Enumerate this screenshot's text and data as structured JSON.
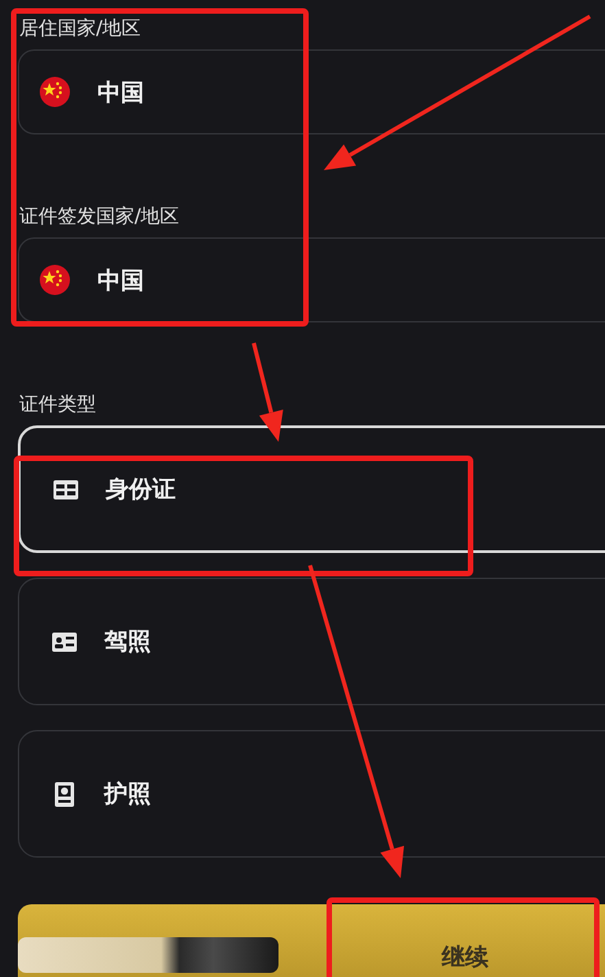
{
  "residence": {
    "label": "居住国家/地区",
    "value": "中国"
  },
  "issuing_country": {
    "label": "证件签发国家/地区",
    "value": "中国"
  },
  "id_type": {
    "label": "证件类型",
    "options": [
      {
        "label": "身份证",
        "kind": "id-card",
        "selected": true
      },
      {
        "label": "驾照",
        "kind": "license",
        "selected": false
      },
      {
        "label": "护照",
        "kind": "passport",
        "selected": false
      }
    ]
  },
  "continue_button": "继续"
}
